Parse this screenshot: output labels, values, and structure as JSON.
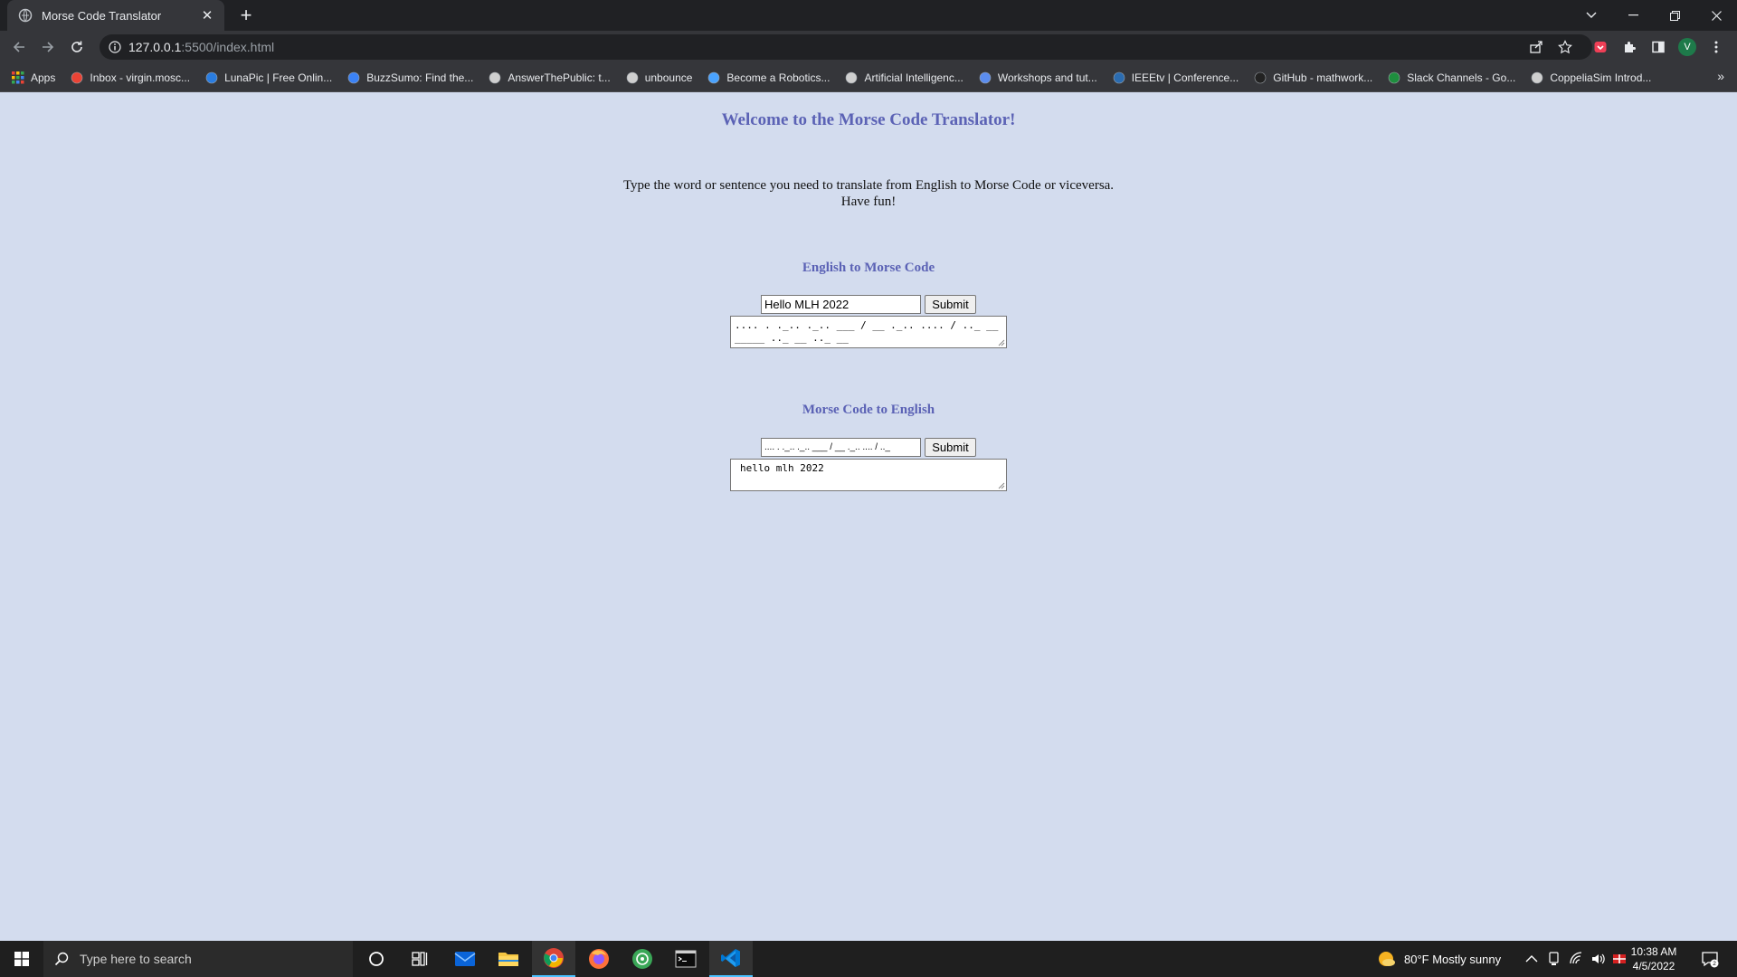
{
  "browser": {
    "tab_title": "Morse Code Translator",
    "tab_close": "✕",
    "new_tab": "+",
    "url_host": "127.0.0.1",
    "url_path": ":5500/index.html",
    "bookmarks": [
      {
        "label": "Apps",
        "icon": "apps-grid-icon",
        "color": "#4285f4"
      },
      {
        "label": "Inbox - virgin.mosc...",
        "icon": "gmail-icon",
        "color": "#ea4335"
      },
      {
        "label": "LunaPic | Free Onlin...",
        "icon": "lunapic-icon",
        "color": "#2a7de1"
      },
      {
        "label": "BuzzSumo: Find the...",
        "icon": "buzzsumo-icon",
        "color": "#3b82f6"
      },
      {
        "label": "AnswerThePublic: t...",
        "icon": "globe-icon",
        "color": "#cfcfcf"
      },
      {
        "label": "unbounce",
        "icon": "globe-icon",
        "color": "#cfcfcf"
      },
      {
        "label": "Become a Robotics...",
        "icon": "udemy-icon",
        "color": "#4aa3ff"
      },
      {
        "label": "Artificial Intelligenc...",
        "icon": "globe-icon",
        "color": "#cfcfcf"
      },
      {
        "label": "Workshops and tut...",
        "icon": "globe-blue-icon",
        "color": "#5b8def"
      },
      {
        "label": "IEEEtv | Conference...",
        "icon": "ieeetv-icon",
        "color": "#2b6cb0"
      },
      {
        "label": "GitHub - mathwork...",
        "icon": "github-icon",
        "color": "#222222"
      },
      {
        "label": "Slack Channels - Go...",
        "icon": "sheets-icon",
        "color": "#1e8e3e"
      },
      {
        "label": "CoppeliaSim Introd...",
        "icon": "globe-icon",
        "color": "#cfcfcf"
      }
    ],
    "bookmarks_more": "»",
    "profile_initial": "V"
  },
  "page": {
    "title": "Welcome to the Morse Code Translator!",
    "intro_line1": "Type the word or sentence you need to translate from English to Morse Code or viceversa.",
    "intro_line2": "Have fun!",
    "english_to_morse": {
      "heading": "English to Morse Code",
      "input_value": "Hello MLH 2022",
      "submit_label": "Submit",
      "output": ".... . ._.. ._.. ___ / __ ._.. .... / .._ __ _____ .._ __ .._ __"
    },
    "morse_to_english": {
      "heading": "Morse Code to English",
      "input_value": ".... . ._.. ._.. ___ / __ ._.. .... / .._",
      "submit_label": "Submit",
      "output": "hello mlh 2022"
    }
  },
  "taskbar": {
    "search_placeholder": "Type here to search",
    "weather": "80°F  Mostly sunny",
    "time": "10:38 AM",
    "date": "4/5/2022",
    "notification_count": "2"
  }
}
